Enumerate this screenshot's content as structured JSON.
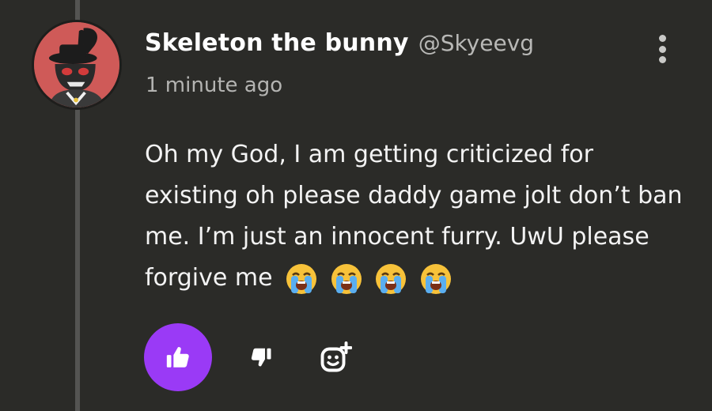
{
  "post": {
    "author": {
      "display_name": "Skeleton the bunny",
      "username": "@Skyeevg",
      "avatar_icon": "bunny-skeleton-avatar"
    },
    "timestamp": "1 minute ago",
    "content": {
      "text": "Oh my God, I am getting criticized for existing oh please daddy game jolt don’t ban me. I’m just an innocent furry. UwU please forgive me",
      "emojis": [
        "loudly-crying-face",
        "loudly-crying-face",
        "loudly-crying-face",
        "loudly-crying-face"
      ]
    }
  },
  "actions": {
    "like_icon": "thumbs-up-icon",
    "dislike_icon": "thumbs-down-icon",
    "reaction_icon": "add-reaction-icon",
    "menu_icon": "more-vertical-icon"
  },
  "colors": {
    "background": "#2b2b28",
    "accent": "#9a3af6",
    "avatar_bg": "#cf5a58"
  }
}
